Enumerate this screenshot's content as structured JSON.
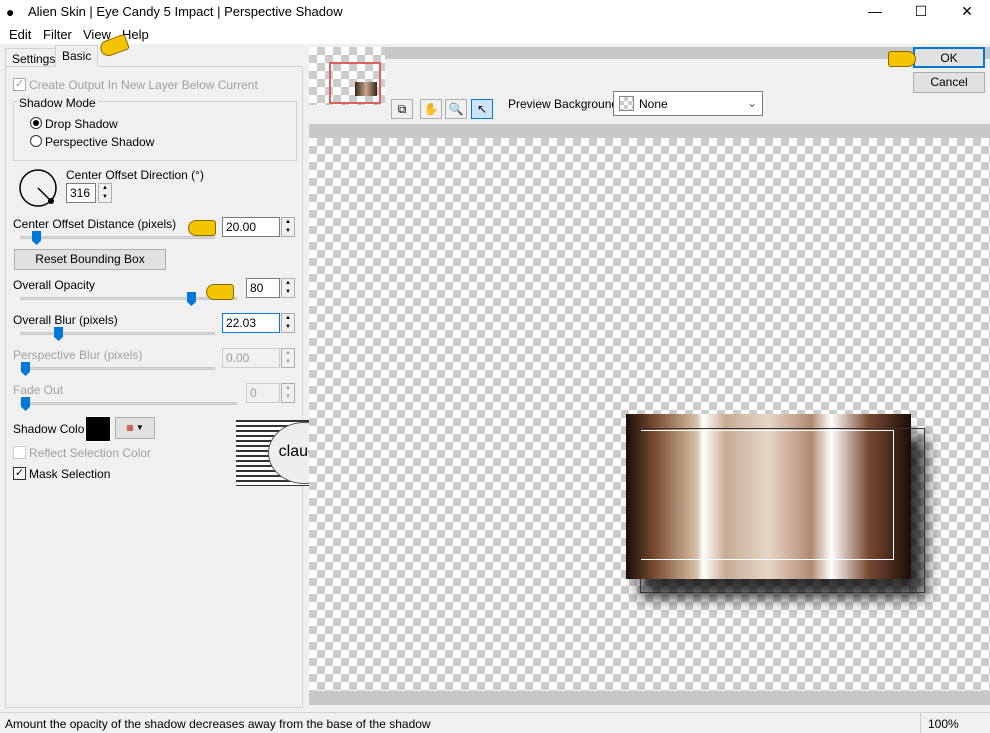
{
  "window": {
    "title": "Alien Skin | Eye Candy 5 Impact | Perspective Shadow",
    "minimize": "—",
    "maximize": "☐",
    "close": "✕"
  },
  "menu": [
    "Edit",
    "Filter",
    "View",
    "Help"
  ],
  "tabs": [
    {
      "label": "Settings",
      "active": false
    },
    {
      "label": "Basic",
      "active": true
    }
  ],
  "basic": {
    "create_output": {
      "label": "Create Output In New Layer Below Current",
      "checked": true,
      "disabled": true
    },
    "shadow_mode": {
      "label": "Shadow Mode",
      "options": [
        "Drop Shadow",
        "Perspective Shadow"
      ],
      "selected": "Drop Shadow"
    },
    "center_offset_direction": {
      "label": "Center Offset Direction (°)",
      "value": "316"
    },
    "center_offset_distance": {
      "label": "Center Offset Distance (pixels)",
      "value": "20.00",
      "slider_fraction": 0.08
    },
    "reset_bounding_box": "Reset Bounding Box",
    "overall_opacity": {
      "label": "Overall Opacity",
      "value": "80",
      "slider_fraction": 0.8
    },
    "overall_blur": {
      "label": "Overall Blur (pixels)",
      "value": "22.03",
      "slider_fraction": 0.19
    },
    "perspective_blur": {
      "label": "Perspective Blur (pixels)",
      "value": "0.00",
      "slider_fraction": 0,
      "disabled": true
    },
    "fade_out": {
      "label": "Fade Out",
      "value": "0",
      "slider_fraction": 0,
      "disabled": true
    },
    "shadow_color": {
      "label": "Shadow Color",
      "color": "#000000"
    },
    "reflect_selection_color": {
      "label": "Reflect Selection Color",
      "checked": false,
      "disabled": true
    },
    "mask_selection": {
      "label": "Mask Selection",
      "checked": true
    }
  },
  "watermark": "claudia",
  "preview": {
    "background_label": "Preview Background:",
    "background_value": "None"
  },
  "buttons": {
    "ok": "OK",
    "cancel": "Cancel"
  },
  "status": {
    "text": "Amount the opacity of the shadow decreases away from the base of the shadow",
    "zoom": "100%"
  },
  "colors": {
    "accent": "#0078d7",
    "pointer_hand": "#f5c400"
  }
}
